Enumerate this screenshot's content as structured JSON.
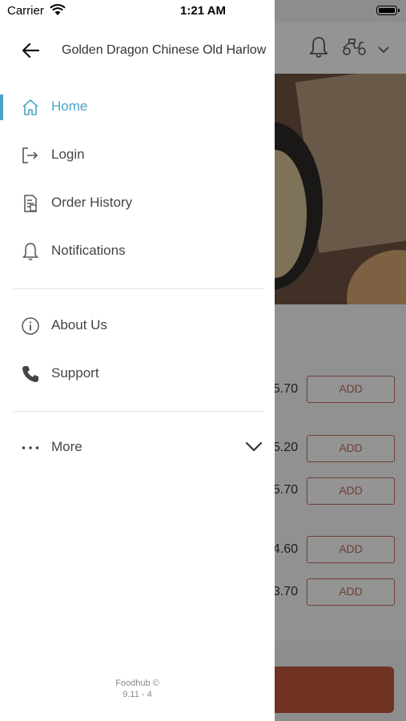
{
  "status_bar": {
    "carrier": "Carrier",
    "time": "1:21 AM"
  },
  "drawer": {
    "restaurant_title": "Golden Dragon Chinese Old Harlow",
    "primary_items": [
      {
        "label": "Home",
        "icon": "home-icon",
        "active": true
      },
      {
        "label": "Login",
        "icon": "login-icon",
        "active": false
      },
      {
        "label": "Order History",
        "icon": "order-history-icon",
        "active": false
      },
      {
        "label": "Notifications",
        "icon": "bell-icon",
        "active": false
      }
    ],
    "secondary_items": [
      {
        "label": "About Us",
        "icon": "info-icon"
      },
      {
        "label": "Support",
        "icon": "phone-icon"
      }
    ],
    "more": {
      "label": "More",
      "icon": "more-dots-icon"
    },
    "footer": {
      "brand": "Foodhub ©",
      "version": "9.11 - 4"
    }
  },
  "background_page": {
    "menu_rows": [
      {
        "price_fragment": "5.70",
        "add_label": "ADD"
      },
      {
        "price_fragment": "5.20",
        "add_label": "ADD"
      },
      {
        "price_fragment": "5.70",
        "add_label": "ADD"
      },
      {
        "price_fragment": "4.60",
        "add_label": "ADD"
      },
      {
        "price_fragment": "3.70",
        "add_label": "ADD"
      }
    ],
    "header_icons": [
      "bell-icon",
      "delivery-scooter-icon",
      "chevron-down-icon"
    ]
  },
  "colors": {
    "accent": "#4aa3c9",
    "add_button": "#c46a5a",
    "cart_bar": "#c0573d"
  }
}
